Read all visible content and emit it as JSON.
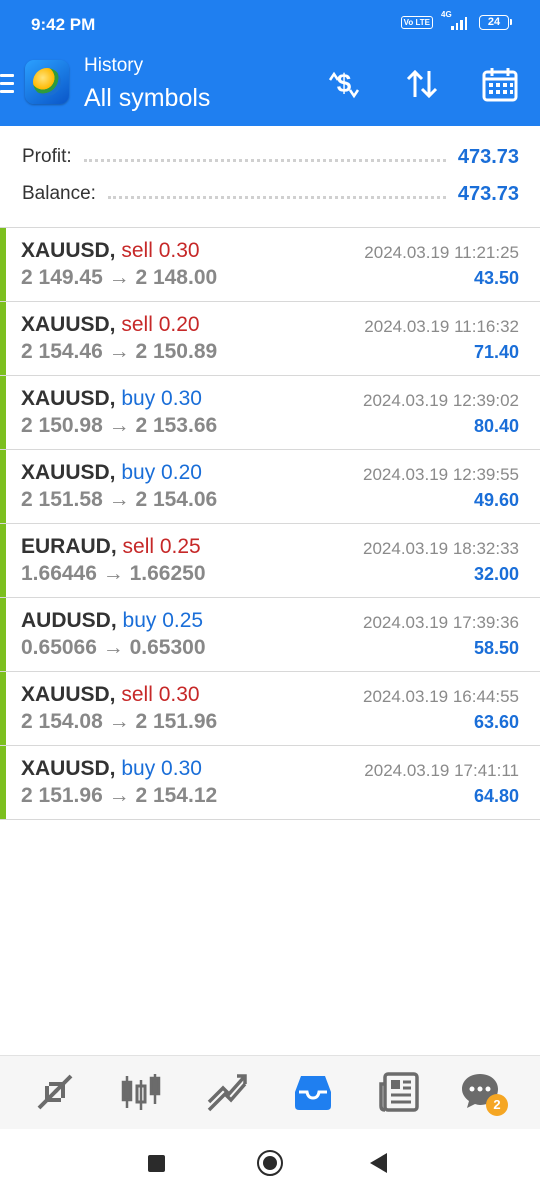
{
  "status_bar": {
    "time": "9:42 PM",
    "volte": "Vo LTE",
    "network": "4G",
    "battery": "24"
  },
  "header": {
    "title": "History",
    "subtitle": "All symbols",
    "icons": [
      "menu-icon",
      "app-logo",
      "currency-sort-icon",
      "sort-arrows-icon",
      "calendar-icon"
    ]
  },
  "summary": {
    "profit_label": "Profit:",
    "profit_value": "473.73",
    "balance_label": "Balance:",
    "balance_value": "473.73"
  },
  "deals": [
    {
      "symbol": "XAUUSD,",
      "type": "sell 0.30",
      "side": "sell",
      "open": "2 149.45",
      "close": "2 148.00",
      "arrow": "→",
      "time": "2024.03.19 11:21:25",
      "profit": "43.50"
    },
    {
      "symbol": "XAUUSD,",
      "type": "sell 0.20",
      "side": "sell",
      "open": "2 154.46",
      "close": "2 150.89",
      "arrow": "→",
      "time": "2024.03.19 11:16:32",
      "profit": "71.40"
    },
    {
      "symbol": "XAUUSD,",
      "type": "buy 0.30",
      "side": "buy",
      "open": "2 150.98",
      "close": "2 153.66",
      "arrow": "→",
      "time": "2024.03.19 12:39:02",
      "profit": "80.40"
    },
    {
      "symbol": "XAUUSD,",
      "type": "buy 0.20",
      "side": "buy",
      "open": "2 151.58",
      "close": "2 154.06",
      "arrow": "→",
      "time": "2024.03.19 12:39:55",
      "profit": "49.60"
    },
    {
      "symbol": "EURAUD,",
      "type": "sell 0.25",
      "side": "sell",
      "open": "1.66446",
      "close": "1.66250",
      "arrow": "→",
      "time": "2024.03.19 18:32:33",
      "profit": "32.00"
    },
    {
      "symbol": "AUDUSD,",
      "type": "buy 0.25",
      "side": "buy",
      "open": "0.65066",
      "close": "0.65300",
      "arrow": "→",
      "time": "2024.03.19 17:39:36",
      "profit": "58.50"
    },
    {
      "symbol": "XAUUSD,",
      "type": "sell 0.30",
      "side": "sell",
      "open": "2 154.08",
      "close": "2 151.96",
      "arrow": "→",
      "time": "2024.03.19 16:44:55",
      "profit": "63.60"
    },
    {
      "symbol": "XAUUSD,",
      "type": "buy 0.30",
      "side": "buy",
      "open": "2 151.96",
      "close": "2 154.12",
      "arrow": "→",
      "time": "2024.03.19 17:41:11",
      "profit": "64.80"
    }
  ],
  "bottom_nav": {
    "items": [
      "quotes-icon",
      "chart-icon",
      "trade-icon",
      "history-icon",
      "news-icon",
      "chat-icon"
    ],
    "active": "history-icon",
    "chat_badge": "2"
  },
  "colors": {
    "accent": "#1f7ff0",
    "sell": "#c62828",
    "buy": "#1a6ed8",
    "profit_bar": "#7cbf1f",
    "badge": "#f5a623"
  }
}
